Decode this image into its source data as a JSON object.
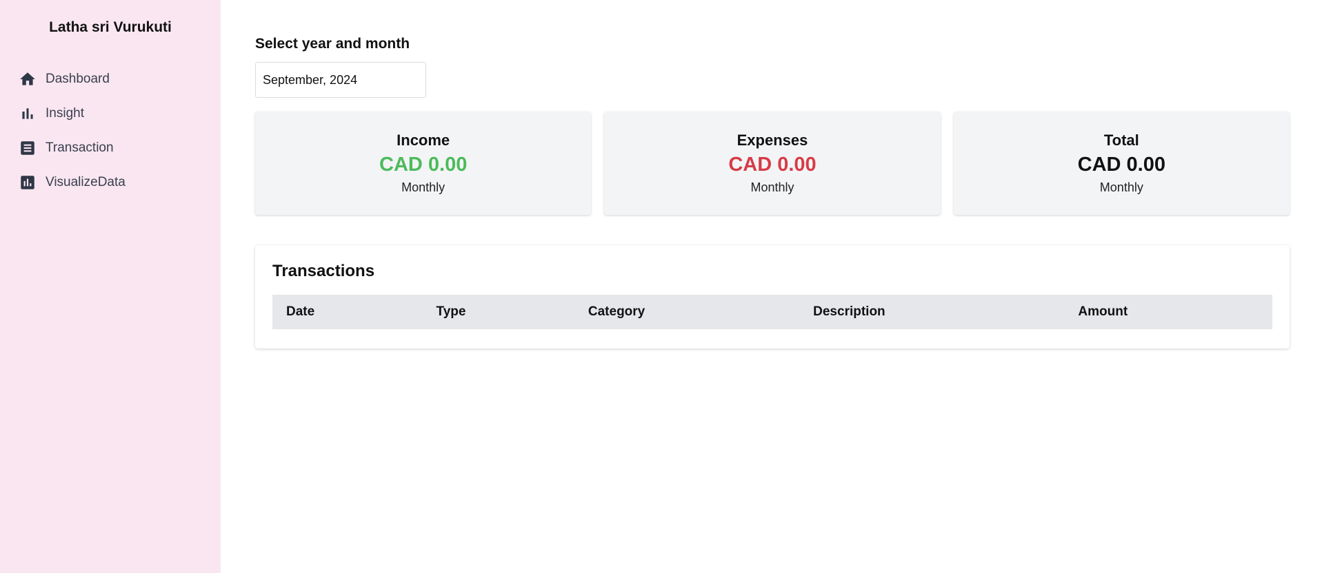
{
  "sidebar": {
    "user_name": "Latha sri Vurukuti",
    "items": [
      {
        "label": "Dashboard",
        "icon": "home-icon"
      },
      {
        "label": "Insight",
        "icon": "bar-chart-icon"
      },
      {
        "label": "Transaction",
        "icon": "receipt-icon"
      },
      {
        "label": "VisualizeData",
        "icon": "analytics-icon"
      }
    ]
  },
  "main": {
    "select_label": "Select year and month",
    "month_value": "September, 2024",
    "cards": [
      {
        "title": "Income",
        "amount": "CAD 0.00",
        "period": "Monthly",
        "color": "#4cbb5a"
      },
      {
        "title": "Expenses",
        "amount": "CAD 0.00",
        "period": "Monthly",
        "color": "#d63c47"
      },
      {
        "title": "Total",
        "amount": "CAD 0.00",
        "period": "Monthly",
        "color": "#111111"
      }
    ],
    "transactions": {
      "title": "Transactions",
      "columns": [
        "Date",
        "Type",
        "Category",
        "Description",
        "Amount"
      ],
      "rows": []
    }
  },
  "colors": {
    "sidebar_bg": "#f9e6f1",
    "card_bg": "#f3f4f6",
    "table_header_bg": "#e5e7eb"
  }
}
